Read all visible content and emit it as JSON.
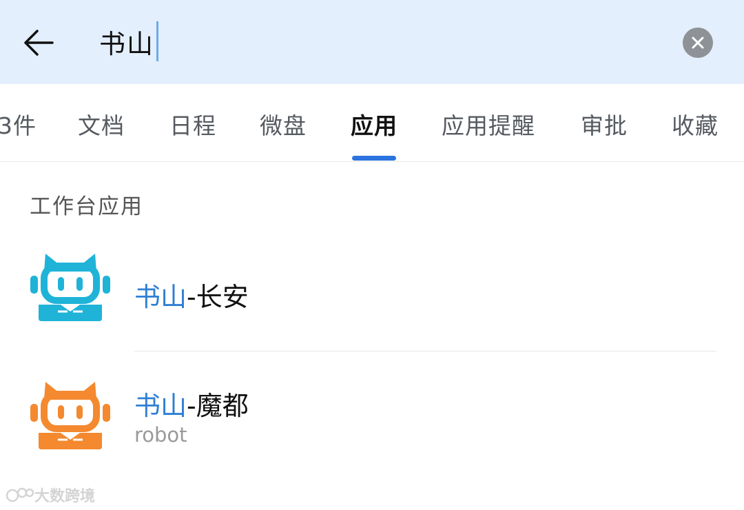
{
  "search": {
    "query": "书山"
  },
  "tabs": [
    {
      "label": "邮件",
      "visible_text": "3件"
    },
    {
      "label": "文档"
    },
    {
      "label": "日程"
    },
    {
      "label": "微盘"
    },
    {
      "label": "应用",
      "active": true
    },
    {
      "label": "应用提醒"
    },
    {
      "label": "审批"
    },
    {
      "label": "收藏"
    }
  ],
  "section": {
    "title": "工作台应用"
  },
  "results": [
    {
      "highlight": "书山",
      "suffix": "-长安",
      "subtitle": "",
      "icon": "robot-icon",
      "icon_color": "#1fb3d8"
    },
    {
      "highlight": "书山",
      "suffix": "-魔都",
      "subtitle": "robot",
      "icon": "robot-icon",
      "icon_color": "#f4892f"
    }
  ],
  "watermark": {
    "text": "大数跨境"
  },
  "colors": {
    "header_bg": "#e3effd",
    "accent": "#2b74e0",
    "highlight": "#2f7fd4"
  }
}
